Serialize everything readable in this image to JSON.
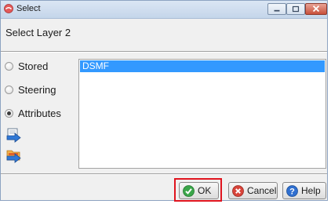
{
  "window": {
    "title": "Select",
    "icons": {
      "app": "app-icon",
      "minimize": "minimize-icon",
      "maximize": "maximize-icon",
      "close": "close-icon"
    }
  },
  "heading": "Select Layer 2",
  "options": [
    {
      "label": "Stored",
      "checked": false
    },
    {
      "label": "Steering",
      "checked": false
    },
    {
      "label": "Attributes",
      "checked": true
    }
  ],
  "tools": [
    {
      "icon": "blue-arrow-into-document-icon"
    },
    {
      "icon": "blue-arrow-into-folder-icon"
    }
  ],
  "list": {
    "items": [
      {
        "label": "DSMF",
        "selected": true
      }
    ]
  },
  "buttons": {
    "ok": {
      "label": "OK",
      "icon": "green-check-icon",
      "highlighted": true
    },
    "cancel": {
      "label": "Cancel",
      "icon": "red-x-icon"
    },
    "help": {
      "label": "Help",
      "icon": "help-question-icon"
    }
  },
  "colors": {
    "selection": "#3399ff",
    "highlight": "#e0141e"
  }
}
